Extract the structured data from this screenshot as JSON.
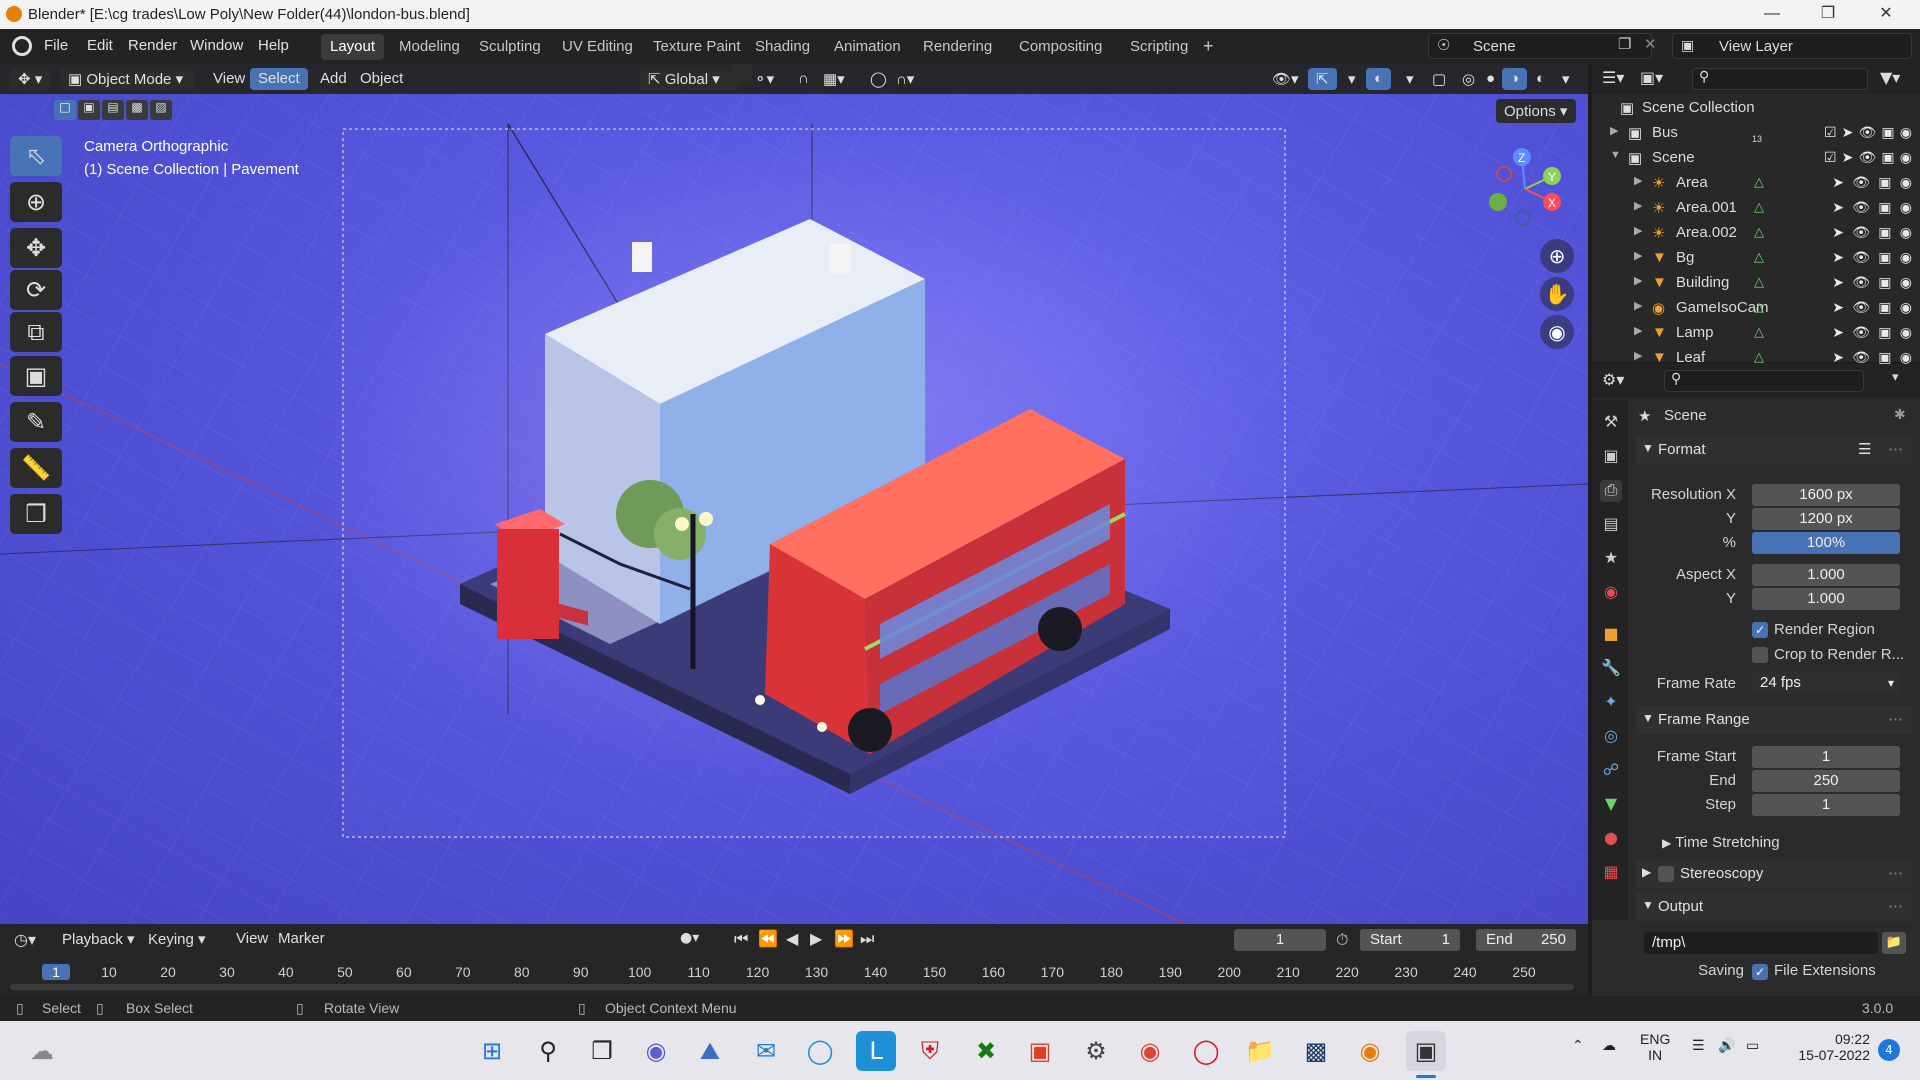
{
  "window": {
    "title": "Blender* [E:\\cg trades\\Low Poly\\New Folder(44)\\london-bus.blend]"
  },
  "menu": [
    "File",
    "Edit",
    "Render",
    "Window",
    "Help"
  ],
  "workspaces": [
    {
      "label": "Layout",
      "active": true
    },
    {
      "label": "Modeling"
    },
    {
      "label": "Sculpting"
    },
    {
      "label": "UV Editing"
    },
    {
      "label": "Texture Paint"
    },
    {
      "label": "Shading"
    },
    {
      "label": "Animation"
    },
    {
      "label": "Rendering"
    },
    {
      "label": "Compositing"
    },
    {
      "label": "Scripting"
    }
  ],
  "add_workspace": "+",
  "scene_field": "Scene",
  "view_layer_field": "View Layer",
  "viewport_header": {
    "mode": "Object Mode",
    "menus": [
      "View",
      "Select",
      "Add",
      "Object"
    ],
    "active_menu": "Select",
    "orientation": "Global",
    "options": "Options"
  },
  "viewport_overlay": {
    "line1": "Camera Orthographic",
    "line2": "(1) Scene Collection | Pavement"
  },
  "gizmo": {
    "z": "Z",
    "y": "Y",
    "x": "X"
  },
  "outliner": {
    "root": "Scene Collection",
    "rows": [
      {
        "name": "Bus",
        "icon": "collection-icon",
        "expanded": false,
        "indent": 1,
        "badge": "13"
      },
      {
        "name": "Scene",
        "icon": "collection-icon",
        "expanded": true,
        "indent": 1
      },
      {
        "name": "Area",
        "icon": "light-icon",
        "indent": 2
      },
      {
        "name": "Area.001",
        "icon": "light-icon",
        "indent": 2
      },
      {
        "name": "Area.002",
        "icon": "light-icon",
        "indent": 2
      },
      {
        "name": "Bg",
        "icon": "mesh-icon",
        "indent": 2
      },
      {
        "name": "Building",
        "icon": "mesh-icon",
        "indent": 2
      },
      {
        "name": "GameIsoCam",
        "icon": "camera-icon",
        "indent": 2
      },
      {
        "name": "Lamp",
        "icon": "mesh-icon",
        "indent": 2
      },
      {
        "name": "Leaf",
        "icon": "mesh-icon",
        "indent": 2
      }
    ]
  },
  "properties": {
    "context": "Scene",
    "format": {
      "title": "Format",
      "res_x_label": "Resolution X",
      "res_x": "1600 px",
      "res_y_label": "Y",
      "res_y": "1200 px",
      "pct_label": "%",
      "pct": "100%",
      "aspect_x_label": "Aspect X",
      "aspect_x": "1.000",
      "aspect_y_label": "Y",
      "aspect_y": "1.000",
      "render_region": "Render Region",
      "render_region_checked": true,
      "crop": "Crop to Render R...",
      "crop_checked": false,
      "frame_rate_label": "Frame Rate",
      "frame_rate": "24 fps"
    },
    "frame_range": {
      "title": "Frame Range",
      "start_label": "Frame Start",
      "start": "1",
      "end_label": "End",
      "end": "250",
      "step_label": "Step",
      "step": "1"
    },
    "time_stretching": "Time Stretching",
    "stereoscopy": "Stereoscopy",
    "output": {
      "title": "Output",
      "path": "/tmp\\",
      "saving": "Saving",
      "file_ext": "File Extensions"
    }
  },
  "timeline": {
    "menus": [
      "Playback",
      "Keying",
      "View",
      "Marker"
    ],
    "current_frame": "1",
    "start_label": "Start",
    "start": "1",
    "end_label": "End",
    "end": "250",
    "ticks": [
      "1",
      "10",
      "20",
      "30",
      "40",
      "50",
      "60",
      "70",
      "80",
      "90",
      "100",
      "110",
      "120",
      "130",
      "140",
      "150",
      "160",
      "170",
      "180",
      "190",
      "200",
      "210",
      "220",
      "230",
      "240",
      "250"
    ]
  },
  "status": {
    "select": "Select",
    "box_select": "Box Select",
    "rotate": "Rotate View",
    "context": "Object Context Menu",
    "version": "3.0.0"
  },
  "tray": {
    "lang1": "ENG",
    "lang2": "IN",
    "time": "09:22",
    "date": "15-07-2022",
    "notif": "4"
  },
  "colors": {
    "accent": "#4772b3",
    "viewport_bg": "#5656dc",
    "bus_red": "#d9343a",
    "blender_orange": "#e87d0d"
  }
}
